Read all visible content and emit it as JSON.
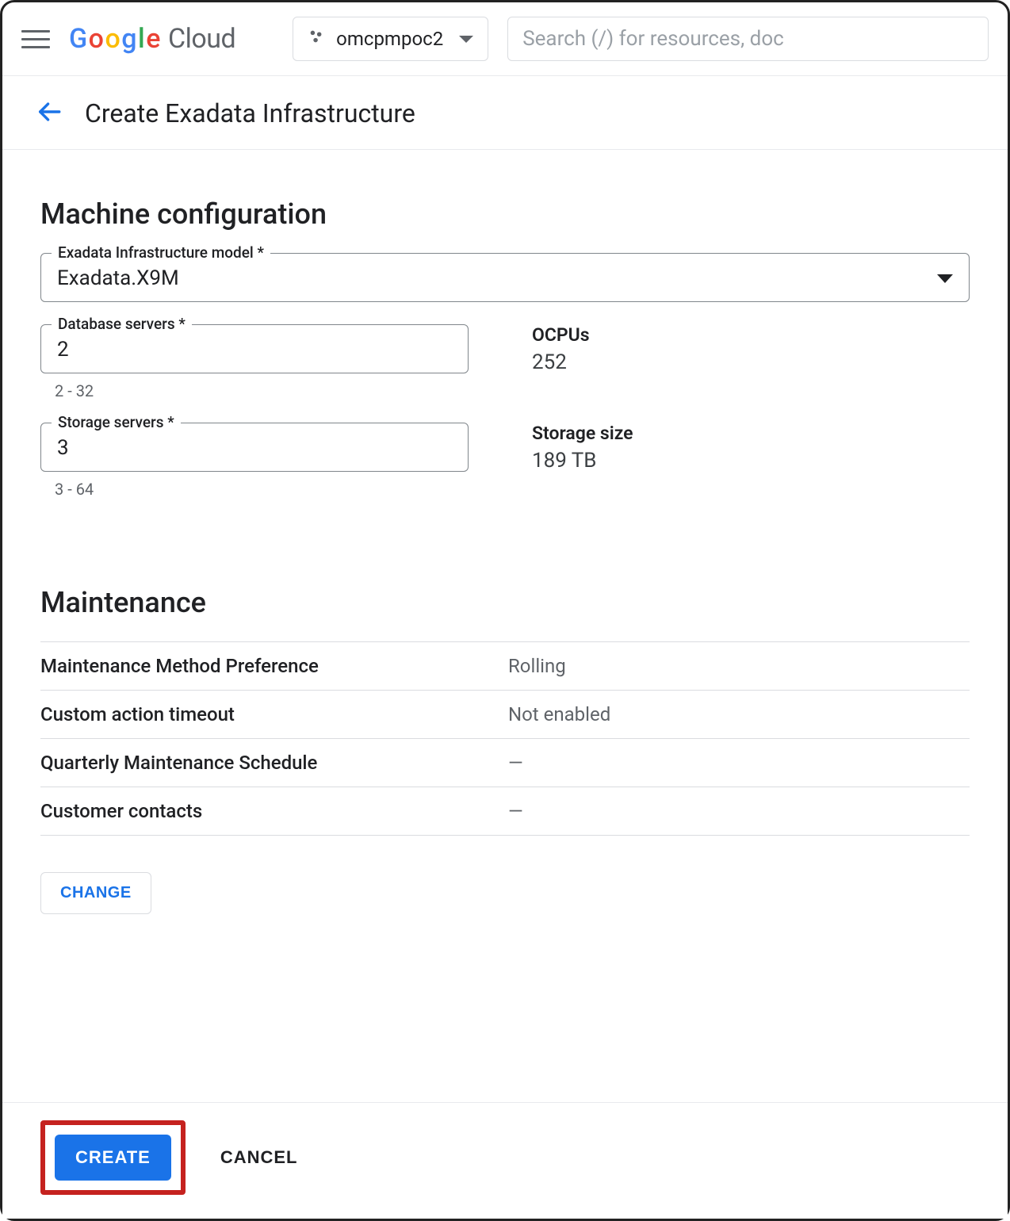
{
  "header": {
    "project_name": "omcpmpoc2",
    "search_placeholder": "Search (/) for resources, doc"
  },
  "page": {
    "title": "Create Exadata Infrastructure"
  },
  "machine_config": {
    "section_title": "Machine configuration",
    "model_label": "Exadata Infrastructure model *",
    "model_value": "Exadata.X9M",
    "db_servers_label": "Database servers *",
    "db_servers_value": "2",
    "db_servers_helper": "2 - 32",
    "ocpus_label": "OCPUs",
    "ocpus_value": "252",
    "storage_servers_label": "Storage servers *",
    "storage_servers_value": "3",
    "storage_servers_helper": "3 - 64",
    "storage_size_label": "Storage size",
    "storage_size_value": "189 TB"
  },
  "maintenance": {
    "section_title": "Maintenance",
    "rows": [
      {
        "label": "Maintenance Method Preference",
        "value": "Rolling"
      },
      {
        "label": "Custom action timeout",
        "value": "Not enabled"
      },
      {
        "label": "Quarterly Maintenance Schedule",
        "value": "—"
      },
      {
        "label": "Customer contacts",
        "value": "—"
      }
    ],
    "change_label": "CHANGE"
  },
  "actions": {
    "create_label": "CREATE",
    "cancel_label": "CANCEL"
  }
}
